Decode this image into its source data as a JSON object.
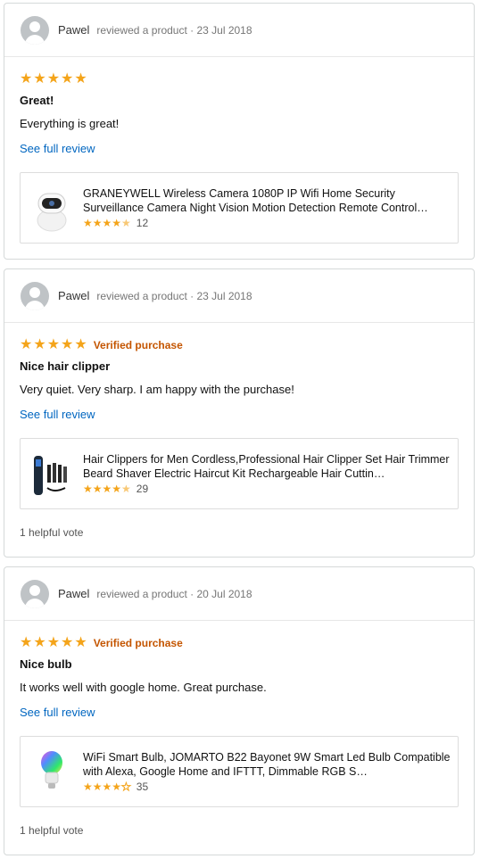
{
  "reviews": [
    {
      "reviewer": "Pawel",
      "meta": "reviewed a product · 23 Jul 2018",
      "stars": 5,
      "verified": "",
      "title": "Great!",
      "text": "Everything is great!",
      "see_full": "See full review",
      "product": {
        "name": "GRANEYWELL Wireless Camera 1080P IP Wifi Home Security Surveillance Camera Night Vision Motion Detection Remote Control…",
        "rating": 4.5,
        "count": "12",
        "icon": "robot-camera-icon"
      },
      "helpful": ""
    },
    {
      "reviewer": "Pawel",
      "meta": "reviewed a product · 23 Jul 2018",
      "stars": 5,
      "verified": "Verified purchase",
      "title": "Nice hair clipper",
      "text": "Very quiet. Very sharp. I am happy with the purchase!",
      "see_full": "See full review",
      "product": {
        "name": "Hair Clippers for Men Cordless,Professional Hair Clipper Set Hair Trimmer Beard Shaver Electric Haircut Kit Rechargeable Hair Cuttin…",
        "rating": 4.5,
        "count": "29",
        "icon": "hair-clipper-icon"
      },
      "helpful": "1 helpful vote"
    },
    {
      "reviewer": "Pawel",
      "meta": "reviewed a product · 20 Jul 2018",
      "stars": 5,
      "verified": "Verified purchase",
      "title": "Nice bulb",
      "text": "It works well with google home. Great purchase.",
      "see_full": "See full review",
      "product": {
        "name": "WiFi Smart Bulb, JOMARTO B22 Bayonet 9W Smart Led Bulb Compatible with Alexa, Google Home and IFTTT, Dimmable RGB S…",
        "rating": 4,
        "count": "35",
        "icon": "smart-bulb-icon"
      },
      "helpful": "1 helpful vote"
    }
  ],
  "colors": {
    "star": "#f4a41a",
    "verified": "#c45500",
    "link": "#0066c0",
    "border": "#d5d9d9"
  }
}
